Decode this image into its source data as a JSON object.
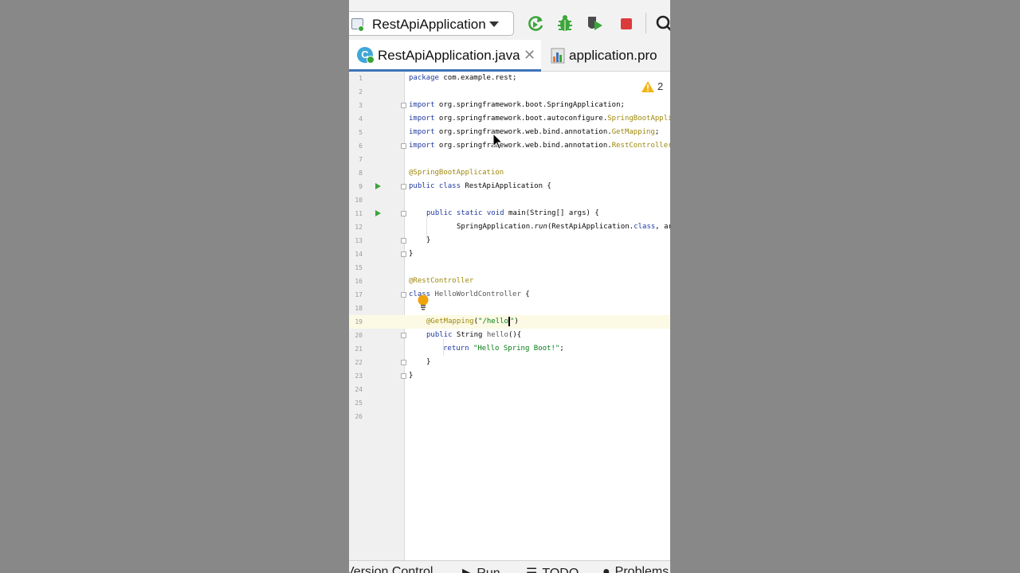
{
  "toolbar": {
    "run_config": "RestApiApplication",
    "buttons": [
      "rerun-icon",
      "debug-icon",
      "coverage-icon",
      "stop-icon",
      "search-icon"
    ]
  },
  "tabs": [
    {
      "label": "RestApiApplication.java",
      "active": true,
      "icon": "java-class-icon"
    },
    {
      "label": "application.pro",
      "active": false,
      "icon": "properties-file-icon"
    }
  ],
  "editor": {
    "warning_count": "2",
    "current_line": 19,
    "lines": [
      {
        "n": "1",
        "text": "package com.example.rest;"
      },
      {
        "n": "2",
        "text": ""
      },
      {
        "n": "3",
        "text": "import org.springframework.boot.SpringApplication;"
      },
      {
        "n": "4",
        "text": "import org.springframework.boot.autoconfigure.SpringBootApplication;"
      },
      {
        "n": "5",
        "text": "import org.springframework.web.bind.annotation.GetMapping;"
      },
      {
        "n": "6",
        "text": "import org.springframework.web.bind.annotation.RestController;"
      },
      {
        "n": "7",
        "text": ""
      },
      {
        "n": "8",
        "text": "@SpringBootApplication"
      },
      {
        "n": "9",
        "text": "public class RestApiApplication {"
      },
      {
        "n": "10",
        "text": ""
      },
      {
        "n": "11",
        "text": "public static void main(String[] args) {"
      },
      {
        "n": "12",
        "text": "SpringApplication.run(RestApiApplication.class, args);"
      },
      {
        "n": "13",
        "text": "}"
      },
      {
        "n": "14",
        "text": "}"
      },
      {
        "n": "15",
        "text": ""
      },
      {
        "n": "16",
        "text": "@RestController"
      },
      {
        "n": "17",
        "text": "class HelloWorldController {"
      },
      {
        "n": "18",
        "text": ""
      },
      {
        "n": "19",
        "text": "@GetMapping(\"/hello\")"
      },
      {
        "n": "20",
        "text": "public String hello(){"
      },
      {
        "n": "21",
        "text": "return \"Hello Spring Boot!\";"
      },
      {
        "n": "22",
        "text": "}"
      },
      {
        "n": "23",
        "text": "}"
      },
      {
        "n": "24",
        "text": ""
      },
      {
        "n": "25",
        "text": ""
      },
      {
        "n": "26",
        "text": ""
      }
    ]
  },
  "bottombar": {
    "version_control": "Version Control",
    "run": "Run",
    "todo": "TODO",
    "problems": "Problems"
  },
  "colors": {
    "keyword": "#1f3aa0",
    "annotation": "#9e880d",
    "string": "#067d17",
    "tab_underline": "#3d72b8",
    "run_green": "#3aa63a",
    "stop_red": "#db3b3b"
  }
}
